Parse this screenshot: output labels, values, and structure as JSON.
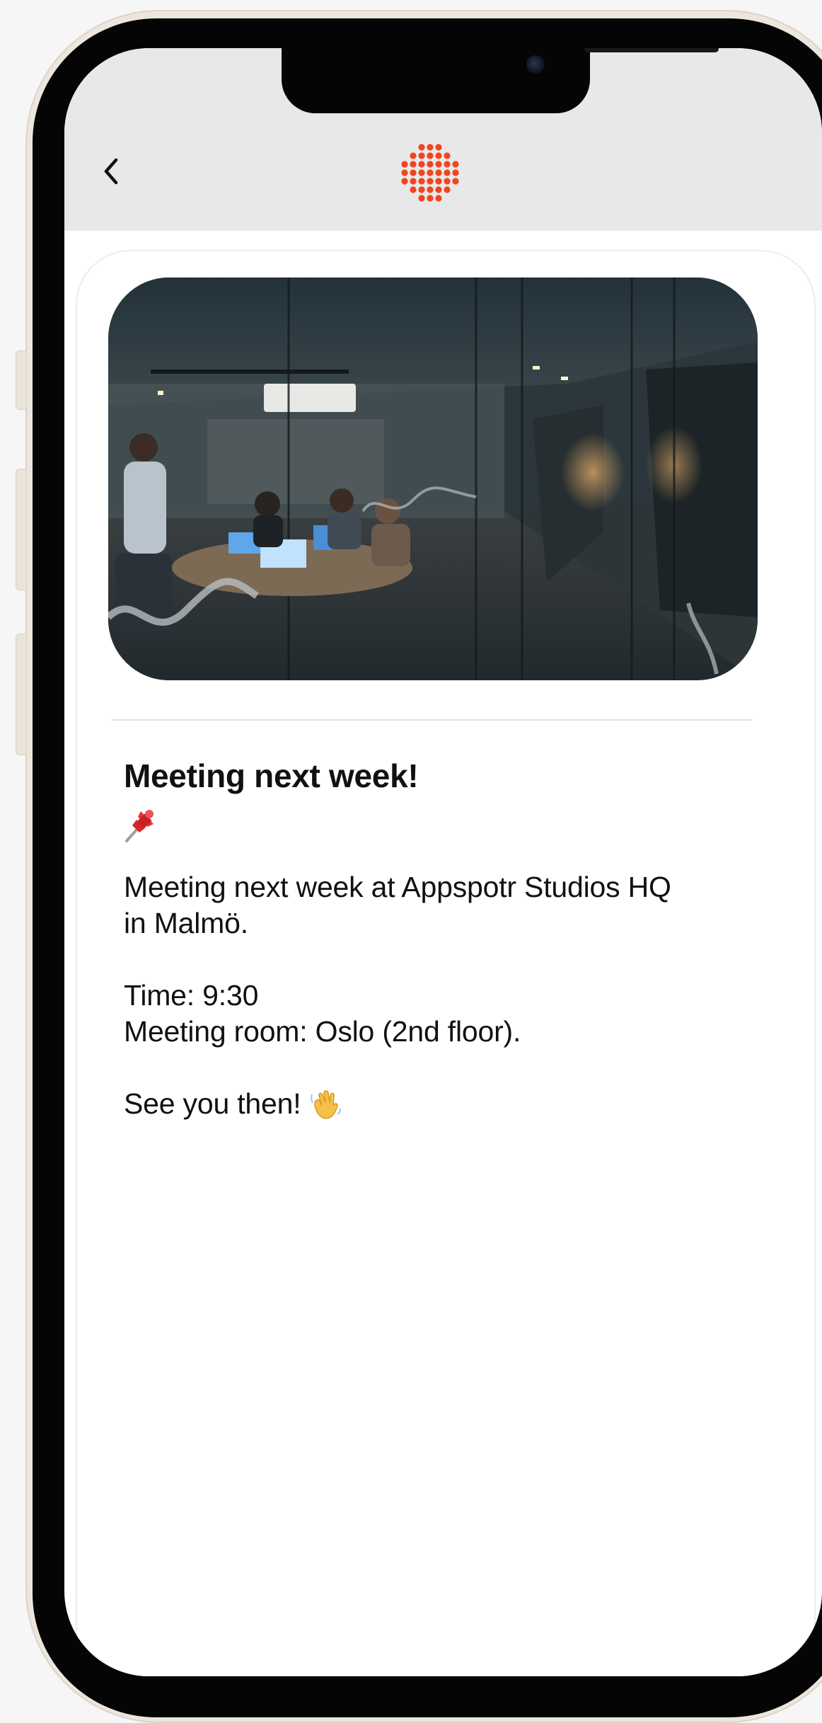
{
  "header": {
    "back_icon": "chevron-left-icon",
    "logo_icon": "dotted-sun-logo",
    "accent_color": "#f2441f"
  },
  "post": {
    "image": "meeting-room-photo",
    "title": "Meeting next week!",
    "title_emoji": "pushpin-icon",
    "body": "Meeting next week at Appspotr Studios HQ\nin Malmö.\n\nTime: 9:30\nMeeting room: Oslo (2nd floor).",
    "signoff": "See you then!",
    "signoff_emoji": "waving-hand-icon"
  }
}
